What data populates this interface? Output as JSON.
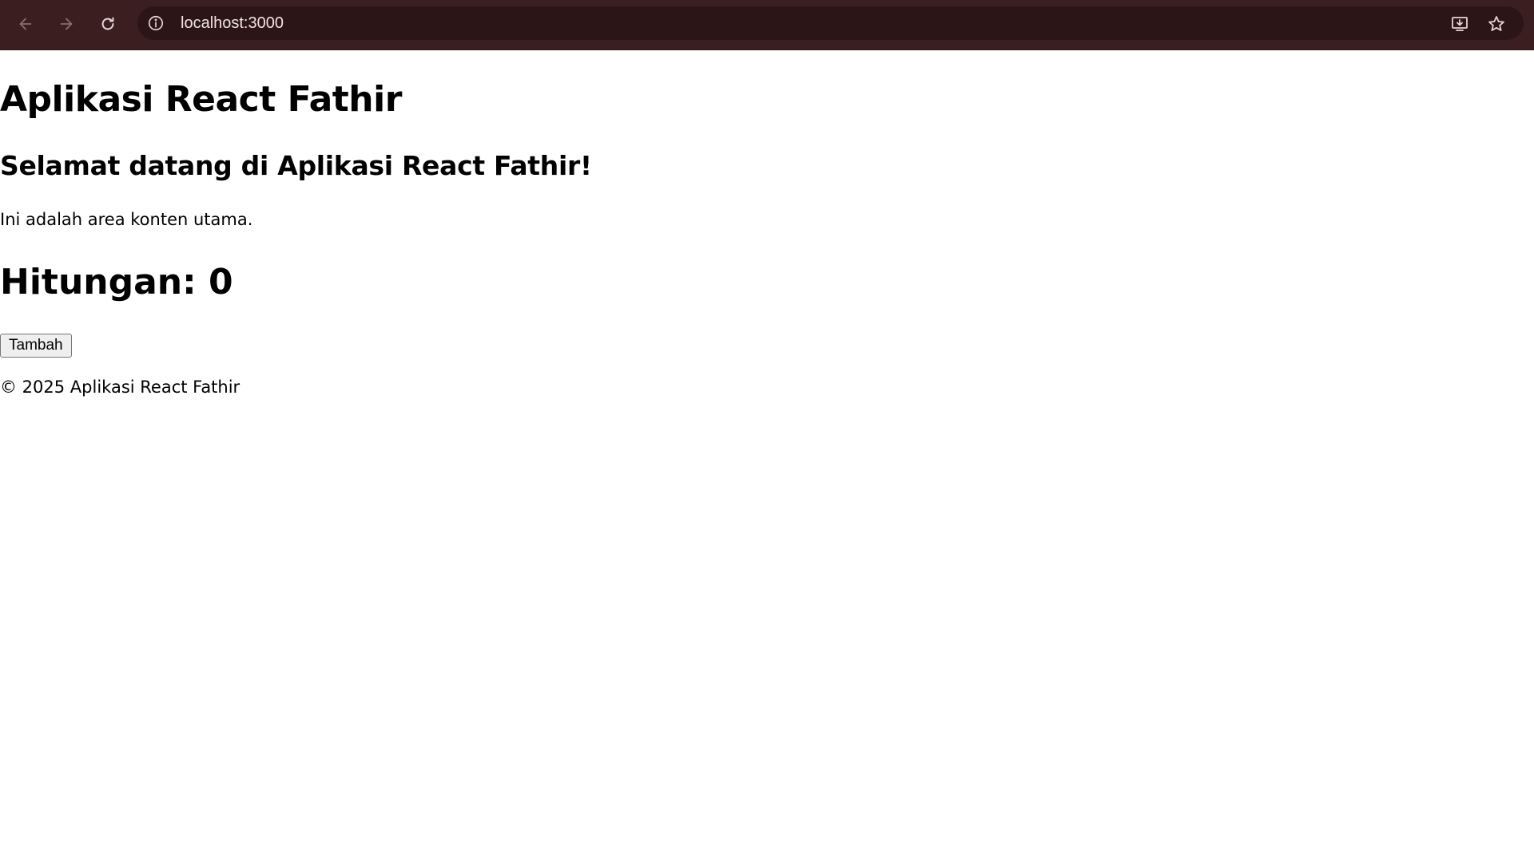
{
  "browser": {
    "url": "localhost:3000",
    "icon_color": "#e6d6d6",
    "disabled_icon_color": "#8a6e6f"
  },
  "page": {
    "app_title": "Aplikasi React Fathir",
    "welcome_heading": "Selamat datang di Aplikasi React Fathir!",
    "content_text": "Ini adalah area konten utama.",
    "counter_text": "Hitungan: 0",
    "add_button_label": "Tambah",
    "footer_text": "© 2025 Aplikasi React Fathir"
  }
}
